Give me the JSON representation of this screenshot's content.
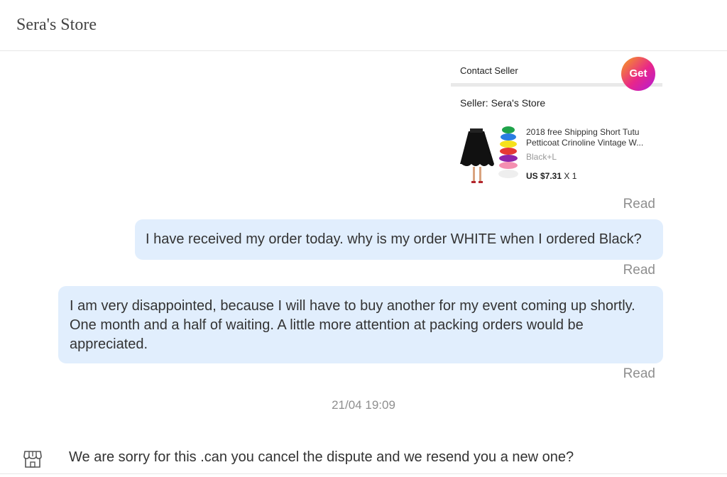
{
  "header": {
    "title": "Sera's Store"
  },
  "product_card": {
    "contact_label": "Contact Seller",
    "get_button": "Get",
    "seller_label": "Seller: Sera's Store",
    "product_title": "2018 free Shipping Short Tutu Petticoat Crinoline Vintage W...",
    "variant": "Black+L",
    "price": "US $7.31",
    "quantity": "X 1"
  },
  "messages": [
    {
      "read_status": "Read"
    },
    {
      "text": "I have received my order today. why is my order WHITE when I ordered Black?",
      "read_status": "Read"
    },
    {
      "text": "I am very disappointed, because I will have to buy another for my event coming up shortly. One month and a half of waiting. A little more attention at packing orders would be appreciated.",
      "read_status": "Read"
    }
  ],
  "timestamp": "21/04 19:09",
  "seller_reply": {
    "icon": "store-icon",
    "text": "We are sorry for this .can you cancel the dispute and we resend you a new one?"
  },
  "colors": {
    "bubble": "#e1eefd",
    "muted_text": "#8f8f8f",
    "get_gradient": [
      "#f7a21b",
      "#e8268a",
      "#b21bd8"
    ]
  }
}
